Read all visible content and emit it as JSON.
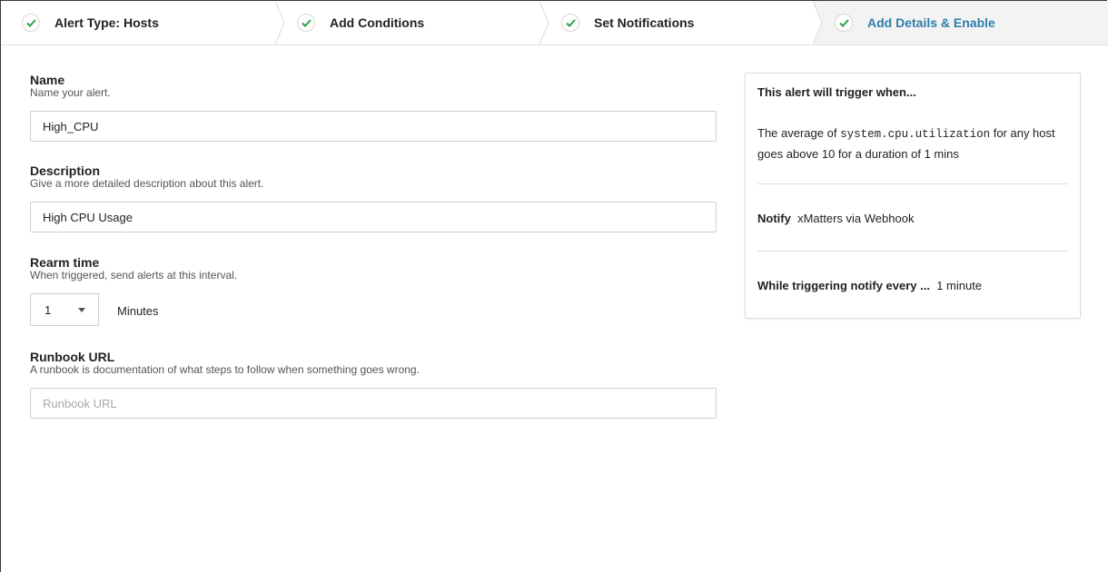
{
  "stepper": {
    "steps": [
      {
        "label": "Alert Type: Hosts",
        "state": "complete"
      },
      {
        "label": "Add Conditions",
        "state": "complete"
      },
      {
        "label": "Set Notifications",
        "state": "complete"
      },
      {
        "label": "Add Details & Enable",
        "state": "active"
      }
    ],
    "check_color": "#2e9e4f",
    "active_color": "#2d7fa8"
  },
  "form": {
    "name": {
      "title": "Name",
      "help": "Name your alert.",
      "value": "High_CPU"
    },
    "description": {
      "title": "Description",
      "help": "Give a more detailed description about this alert.",
      "value": "High CPU Usage"
    },
    "rearm": {
      "title": "Rearm time",
      "help": "When triggered, send alerts at this interval.",
      "selected": "1",
      "unit": "Minutes"
    },
    "runbook": {
      "title": "Runbook URL",
      "help": "A runbook is documentation of what steps to follow when something goes wrong.",
      "value": "",
      "placeholder": "Runbook URL"
    }
  },
  "summary": {
    "title": "This alert will trigger when...",
    "condition_prefix": "The average of ",
    "metric": "system.cpu.utilization",
    "condition_suffix": " for any host goes above 10 for a duration of 1 mins",
    "notify_label": "Notify",
    "notify_value": "xMatters via Webhook",
    "while_label": "While triggering notify every ...",
    "while_value": "1 minute"
  }
}
